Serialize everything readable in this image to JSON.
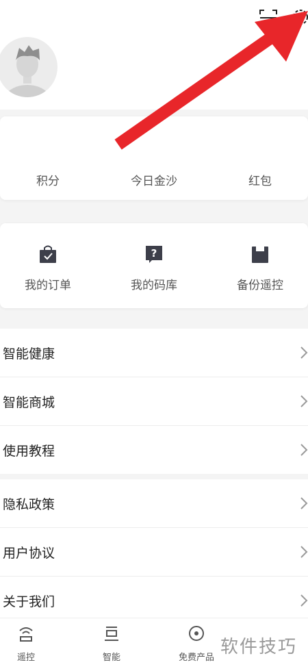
{
  "header": {
    "scan_icon": "scan-icon",
    "settings_icon": "gear-icon"
  },
  "stats": {
    "points": "积分",
    "today_gold": "今日金沙",
    "red_packet": "红包"
  },
  "quick": {
    "orders": "我的订单",
    "code_library": "我的码库",
    "backup_remote": "备份遥控"
  },
  "menu_group1": [
    "智能健康",
    "智能商城",
    "使用教程"
  ],
  "menu_group2": [
    "隐私政策",
    "用户协议",
    "关于我们"
  ],
  "tabs": [
    "遥控",
    "智能",
    "免费产品"
  ],
  "watermark": "软件技巧",
  "colors": {
    "arrow": "#e8262a",
    "icon_dark": "#3d3f4a",
    "chevron": "#9a9a9a"
  }
}
